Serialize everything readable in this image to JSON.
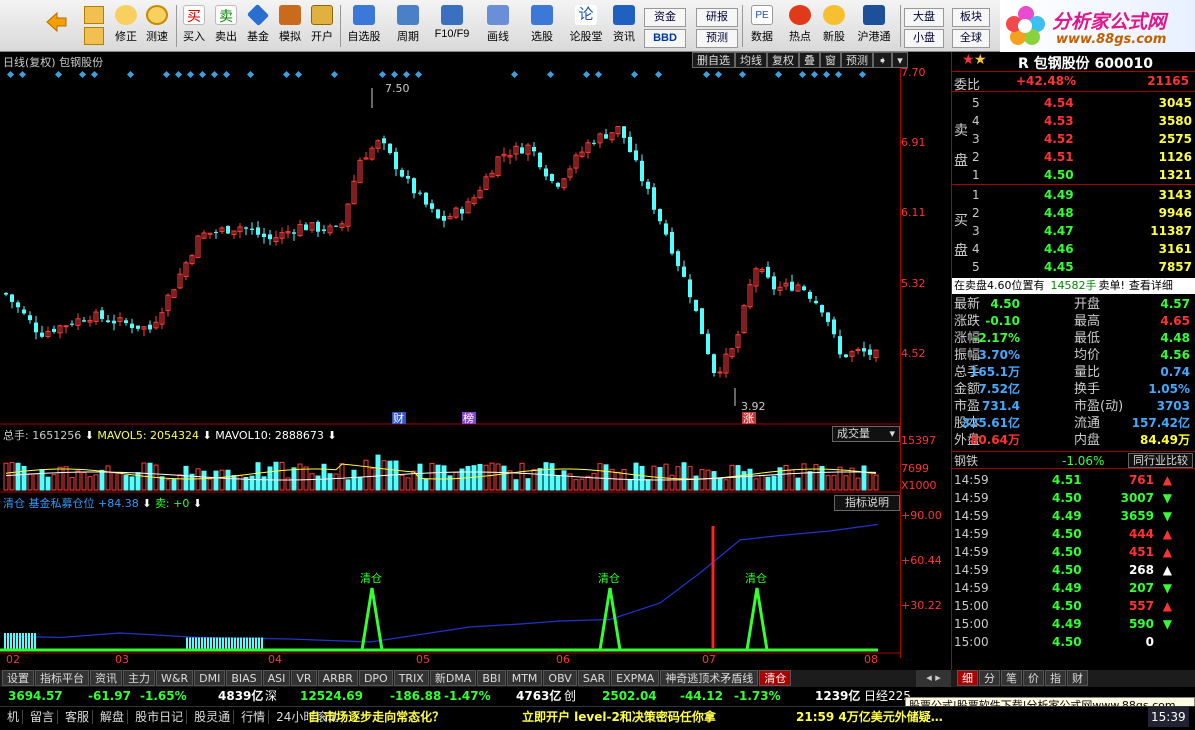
{
  "toolbar": {
    "buttons": [
      {
        "label": "",
        "icon": "back-arrow-icon"
      },
      {
        "label": "修正",
        "icon": "adjust-icon"
      },
      {
        "label": "测速",
        "icon": "clock-icon"
      },
      {
        "label": "买入",
        "icon": "buy-icon",
        "glyph": "买"
      },
      {
        "label": "卖出",
        "icon": "sell-icon",
        "glyph": "卖"
      },
      {
        "label": "基金",
        "icon": "fund-icon"
      },
      {
        "label": "模拟",
        "icon": "hammer-icon"
      },
      {
        "label": "开户",
        "icon": "lock-icon"
      },
      {
        "label": "自选股",
        "icon": "star-list-icon"
      },
      {
        "label": "周期",
        "icon": "period-icon"
      },
      {
        "label": "F10/F9",
        "icon": "f10-icon"
      },
      {
        "label": "画线",
        "icon": "pen-icon"
      },
      {
        "label": "选股",
        "icon": "select-stock-icon"
      },
      {
        "label": "论股堂",
        "icon": "forum-icon",
        "glyph": "论"
      },
      {
        "label": "资讯",
        "icon": "news-icon"
      },
      {
        "label": "数据",
        "icon": "pe-icon",
        "glyph": "PE"
      },
      {
        "label": "热点",
        "icon": "hot-icon"
      },
      {
        "label": "新股",
        "icon": "new-stock-icon"
      },
      {
        "label": "沪港通",
        "icon": "hk-connect-icon"
      }
    ],
    "pills": [
      "资金",
      "研报",
      "BBD",
      "预测",
      "大盘",
      "板块",
      "小盘",
      "全球"
    ],
    "logo_title": "分析家公式网",
    "logo_url": "www.88gs.com"
  },
  "main_chart": {
    "header": "日线(复权)  包钢股份",
    "tabs": [
      "删自选",
      "均线",
      "复权",
      "叠",
      "窗",
      "预测"
    ],
    "axis": [
      "7.70",
      "6.91",
      "6.11",
      "5.32",
      "4.52"
    ],
    "high_label": "7.50",
    "low_label": "3.92",
    "markers": [
      "财",
      "榜",
      "涨"
    ]
  },
  "volume": {
    "total": "总手: 1651256",
    "mavol5": "MAVOL5: 2054324",
    "mavol10": "MAVOL10: 2888673",
    "selector": "成交量",
    "axis": [
      "15397",
      "7699",
      "X1000"
    ]
  },
  "indicator": {
    "title": "清仓  基金私募仓位",
    "value": "+84.38",
    "sell": "卖: +0",
    "explain": "指标说明",
    "axis": [
      "+90.00",
      "+60.44",
      "+30.22"
    ],
    "signals": [
      "清仓",
      "清仓",
      "清仓",
      "清仓"
    ]
  },
  "x_labels": [
    "02",
    "03",
    "04",
    "05",
    "06",
    "07",
    "08"
  ],
  "bottom_tabs": [
    "设置",
    "指标平台",
    "资讯",
    "主力",
    "W&R",
    "DMI",
    "BIAS",
    "ASI",
    "VR",
    "ARBR",
    "DPO",
    "TRIX",
    "新DMA",
    "BBI",
    "MTM",
    "OBV",
    "SAR",
    "EXPMA",
    "神奇逃顶术矛盾线",
    "清仓"
  ],
  "right_tabs": [
    "细",
    "分",
    "笔",
    "价",
    "指",
    "财"
  ],
  "status": {
    "sh_index": "3694.57",
    "sh_chg": "-61.97",
    "sh_pct": "-1.65%",
    "sh_amt": "4839亿",
    "sz_label": "深",
    "sz_index": "12524.69",
    "sz_chg": "-186.88",
    "sz_pct": "-1.47%",
    "sz_amt": "4763亿",
    "cy_label": "创",
    "cy_index": "2502.04",
    "cy_chg": "-44.12",
    "cy_pct": "-1.73%",
    "cy_amt": "1239亿",
    "nk_label": "日经225",
    "download": "股票公式|股票软件下载|分析家公式网www.88gs.com"
  },
  "ticker": {
    "items": [
      "机",
      "留言",
      "客服",
      "解盘",
      "股市日记",
      "股灵通",
      "行情",
      "24小时滚动"
    ],
    "news1": "自  市场逐步走向常态化？",
    "news2": "立即开户  level-2和决策密码任你拿",
    "news3": "21:59  4万亿美元外储疑…",
    "time": "15:39"
  },
  "quote": {
    "stock": "R 包钢股份  600010",
    "weibi_label": "委比",
    "weibi": "+42.48%",
    "weicha": "21165",
    "sell_label": "卖盘",
    "buy_label": "买盘",
    "sell": [
      {
        "lvl": "5",
        "px": "4.54",
        "vol": "3045"
      },
      {
        "lvl": "4",
        "px": "4.53",
        "vol": "3580"
      },
      {
        "lvl": "3",
        "px": "4.52",
        "vol": "2575"
      },
      {
        "lvl": "2",
        "px": "4.51",
        "vol": "1126"
      },
      {
        "lvl": "1",
        "px": "4.50",
        "vol": "1321"
      }
    ],
    "buy": [
      {
        "lvl": "1",
        "px": "4.49",
        "vol": "3143"
      },
      {
        "lvl": "2",
        "px": "4.48",
        "vol": "9946"
      },
      {
        "lvl": "3",
        "px": "4.47",
        "vol": "11387"
      },
      {
        "lvl": "4",
        "px": "4.46",
        "vol": "3161"
      },
      {
        "lvl": "5",
        "px": "4.45",
        "vol": "7857"
      }
    ],
    "notice_a": "在卖盘4.60位置有",
    "notice_b": "14582手",
    "notice_c": "卖单!",
    "notice_d": "查看详细",
    "stats": [
      [
        "最新",
        "4.50",
        "开盘",
        "4.57"
      ],
      [
        "涨跌",
        "-0.10",
        "最高",
        "4.65"
      ],
      [
        "涨幅",
        "-2.17%",
        "最低",
        "4.48"
      ],
      [
        "振幅",
        "3.70%",
        "均价",
        "4.56"
      ],
      [
        "总手",
        "165.1万",
        "量比",
        "0.74"
      ],
      [
        "金额",
        "7.52亿",
        "换手",
        "1.05%"
      ],
      [
        "市盈",
        "731.4",
        "市盈(动)",
        "3703"
      ],
      [
        "股本",
        "325.61亿",
        "流通",
        "157.42亿"
      ],
      [
        "外盘",
        "80.64万",
        "内盘",
        "84.49万"
      ]
    ],
    "industry": "钢铁",
    "industry_pct": "-1.06%",
    "industry_btn": "同行业比较",
    "ticks": [
      {
        "t": "14:59",
        "p": "4.51",
        "v": "761",
        "d": "up"
      },
      {
        "t": "14:59",
        "p": "4.50",
        "v": "3007",
        "d": "down"
      },
      {
        "t": "14:59",
        "p": "4.49",
        "v": "3659",
        "d": "down"
      },
      {
        "t": "14:59",
        "p": "4.50",
        "v": "444",
        "d": "up"
      },
      {
        "t": "14:59",
        "p": "4.50",
        "v": "451",
        "d": "up"
      },
      {
        "t": "14:59",
        "p": "4.50",
        "v": "268",
        "d": "up"
      },
      {
        "t": "14:59",
        "p": "4.49",
        "v": "207",
        "d": "down"
      },
      {
        "t": "15:00",
        "p": "4.50",
        "v": "557",
        "d": "up"
      },
      {
        "t": "15:00",
        "p": "4.49",
        "v": "590",
        "d": "down"
      },
      {
        "t": "15:00",
        "p": "4.50",
        "v": "0",
        "d": "none"
      }
    ]
  },
  "colors": {
    "up": "#ff3333",
    "down": "#54ffff",
    "green": "#33ff33",
    "yellow": "#ffff44",
    "accent": "#00ccff"
  }
}
